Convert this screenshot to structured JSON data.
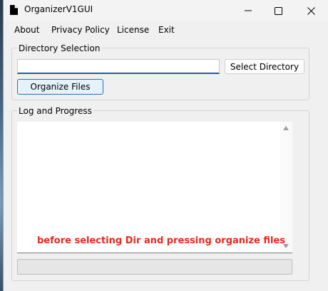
{
  "window": {
    "title": "OrganizerV1GUI",
    "controls": {
      "minimize": "–",
      "maximize": "☐",
      "close": "✕"
    }
  },
  "menu": {
    "items": [
      "About",
      "Privacy Policy",
      "License",
      "Exit"
    ]
  },
  "directory_selection": {
    "group_label": "Directory Selection",
    "path_value": "",
    "select_button_label": "Select Directory",
    "organize_button_label": "Organize Files"
  },
  "log": {
    "group_label": "Log and Progress",
    "annotation": "before selecting Dir and pressing organize files",
    "annotation_color": "#e8281e"
  },
  "progress": {
    "value": 0
  },
  "icons": {
    "app": "document-icon"
  }
}
